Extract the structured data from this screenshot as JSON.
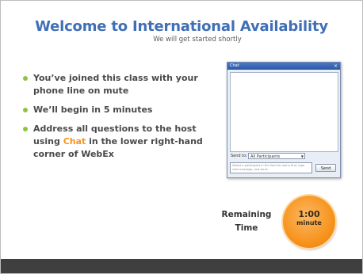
{
  "slide": {
    "title": "Welcome to International Availability",
    "subtitle": "We will get started shortly",
    "bullets": [
      {
        "text": "You’ve joined this class with your phone line on mute"
      },
      {
        "text": "We’ll begin in 5 minutes"
      },
      {
        "pre": "Address all questions to the host using ",
        "highlight": "Chat",
        "post": " in the lower right-hand corner of WebEx"
      }
    ],
    "remaining_label_line1": "Remaining",
    "remaining_label_line2": "Time",
    "timer_value": "1:00",
    "timer_unit": "minute"
  },
  "chat_window": {
    "title": "Chat",
    "close_glyph": "×",
    "send_to_label": "Send to:",
    "send_to_value": "All Participants",
    "message_placeholder": "Select a participant in the Send to menu first, type chat message, and send...",
    "send_label": "Send"
  },
  "colors": {
    "title": "#3f6fb6",
    "bullet": "#8cc63e",
    "highlight": "#f7941d",
    "timer": "#f7941d",
    "footer": "#3f3f3f"
  }
}
